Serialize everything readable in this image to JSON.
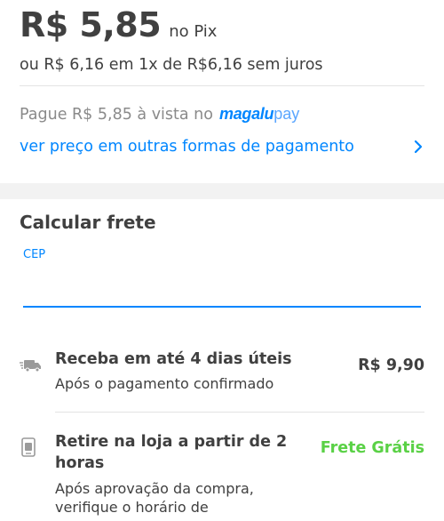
{
  "price": {
    "value": "R$ 5,85",
    "method": "no Pix",
    "installments": "ou R$ 6,16 em 1x de R$6,16 sem juros"
  },
  "magalupay": {
    "text": "Pague R$ 5,85 à vista no",
    "logo_strong": "magalu",
    "logo_light": "pay"
  },
  "other_payments": {
    "label": "ver preço em outras formas de pagamento",
    "icon": "chevron-right-icon"
  },
  "freight": {
    "title": "Calcular frete",
    "cep_label": "CEP",
    "cep_value": ""
  },
  "options": [
    {
      "icon": "truck-icon",
      "title": "Receba em até 4 dias úteis",
      "subtitle": "Após o pagamento confirmado",
      "price": "R$ 9,90"
    },
    {
      "icon": "store-pickup-icon",
      "title_line1": "Retire na loja a partir de 2",
      "title_line2": "horas",
      "subtitle_line1": "Após aprovação da compra,",
      "subtitle_line2": "verifique o horário de",
      "price": "Frete Grátis"
    }
  ],
  "colors": {
    "accent": "#0086ff",
    "text": "#404040",
    "muted": "#8a8a8a",
    "free_shipping": "#5ad146"
  }
}
